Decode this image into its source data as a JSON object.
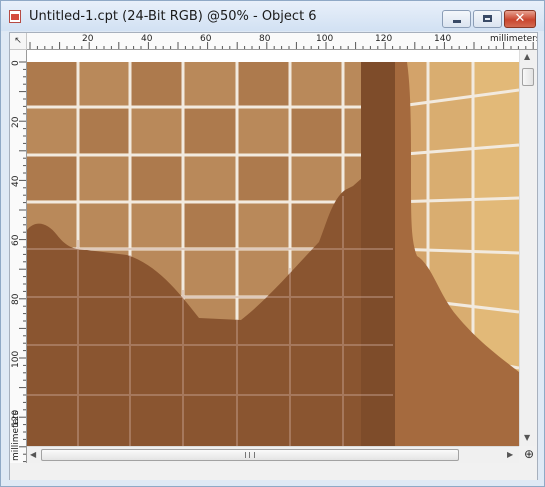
{
  "window": {
    "title": "Untitled-1.cpt (24-Bit RGB) @50% - Object 6",
    "close_glyph": "✕"
  },
  "icons": {
    "app": "corel-photo-document-icon",
    "minimize": "minimize-icon",
    "maximize": "maximize-icon",
    "close": "close-icon",
    "ruler_origin": "ruler-origin-icon",
    "zoom": "zoom-icon",
    "scroll_up": "arrow-up-icon",
    "scroll_down": "arrow-down-icon",
    "scroll_left": "arrow-left-icon",
    "scroll_right": "arrow-right-icon"
  },
  "ruler_corner": "↖",
  "rulers": {
    "horizontal": {
      "labels": [
        "20",
        "40",
        "60",
        "80",
        "100",
        "120",
        "140"
      ],
      "unit": "millimeters"
    },
    "vertical": {
      "labels": [
        "0",
        "20",
        "40",
        "60",
        "80",
        "100",
        "120"
      ],
      "unit": "millimeters"
    }
  },
  "scroll": {
    "up": "▲",
    "down": "▼",
    "left": "◀",
    "right": "▶",
    "zoom_glyph": "⊕"
  },
  "colors": {
    "tile_light": "#b9895a",
    "tile_mid": "#ad7a4d",
    "grid_line": "#f2eadf",
    "silhouette": "#8a5530",
    "right_wall_light": "#e2b978",
    "right_wall_dark": "#a56a3e"
  }
}
